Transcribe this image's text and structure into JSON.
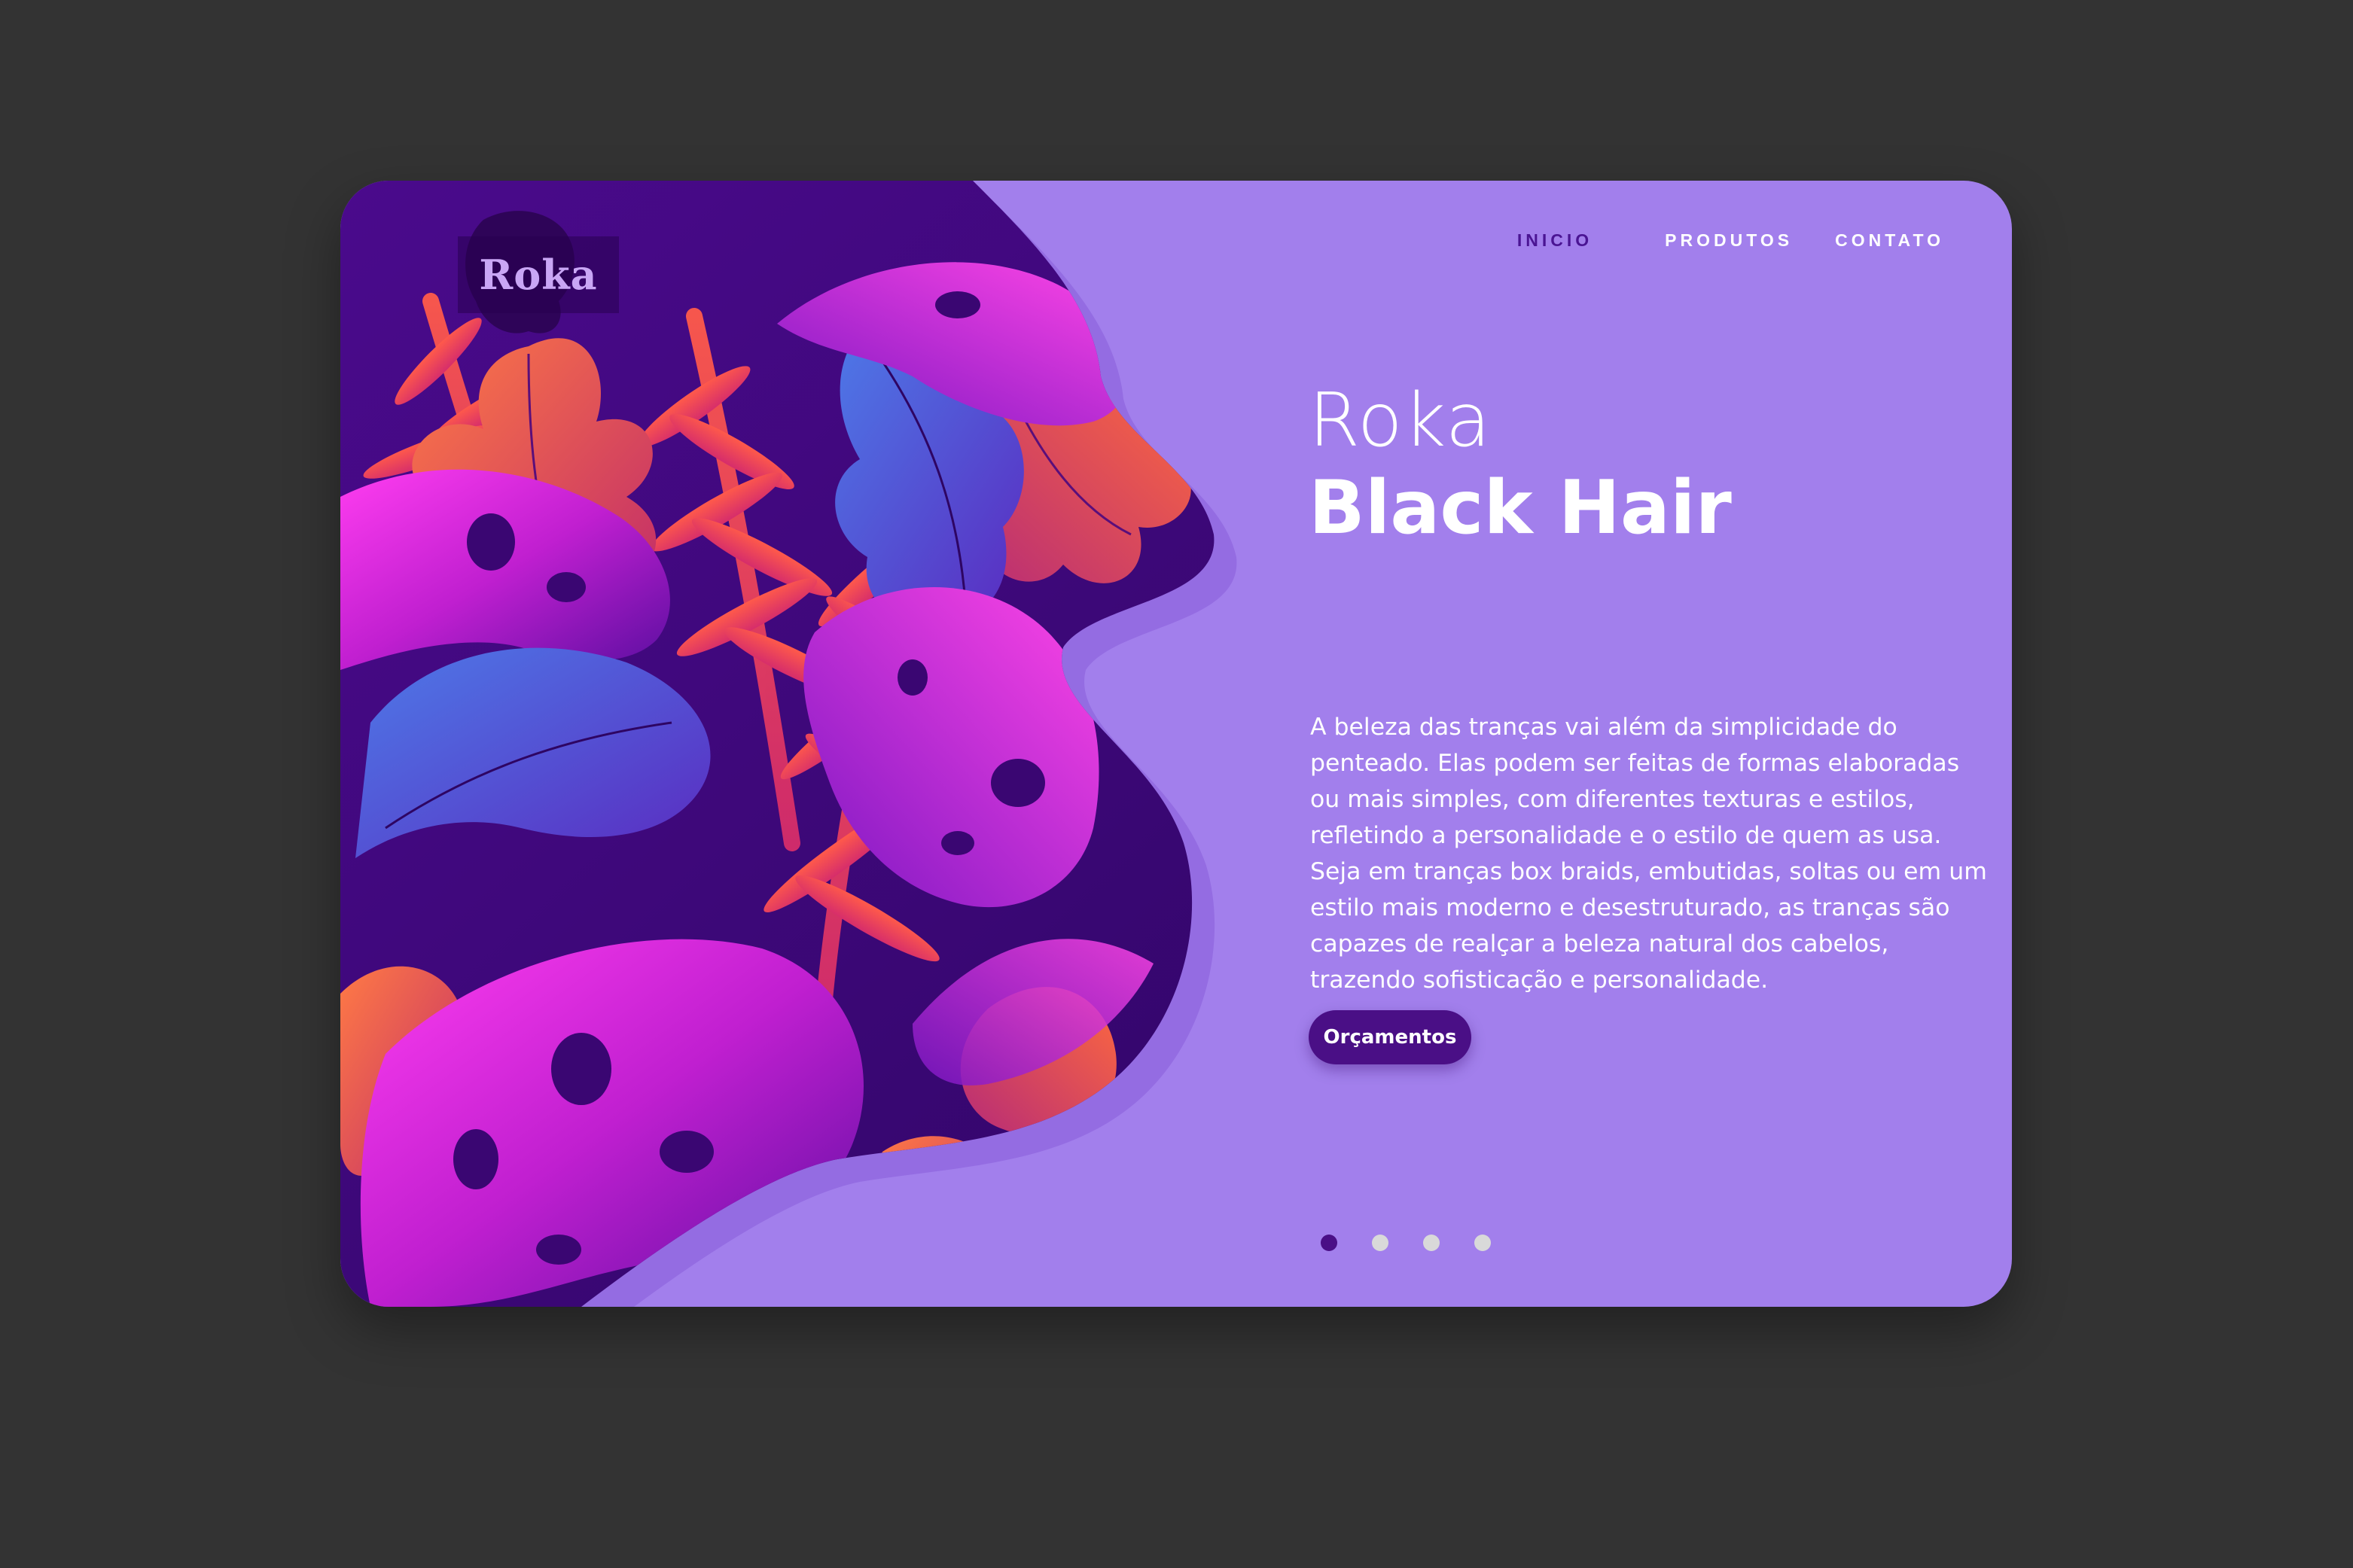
{
  "logo": {
    "text": "Roka"
  },
  "nav": {
    "items": [
      {
        "label": "INICIO",
        "active": true
      },
      {
        "label": "PRODUTOS",
        "active": false
      },
      {
        "label": "CONTATO",
        "active": false
      }
    ]
  },
  "hero": {
    "title_line1": "Roka",
    "title_line2": "Black Hair",
    "description": "A beleza das tranças vai além da simplicidade do penteado. Elas podem ser feitas de formas elaboradas ou mais simples, com diferentes texturas e estilos, refletindo a personalidade e o estilo de quem as usa. Seja em tranças box braids, embutidas, soltas ou em um estilo mais moderno e desestruturado, as tranças são capazes de realçar a beleza natural dos cabelos, trazendo sofisticação e personalidade.",
    "cta_label": "Orçamentos"
  },
  "carousel": {
    "slide_count": 4,
    "active_index": 0
  },
  "colors": {
    "page_background": "#333333",
    "card_background": "#a27fec",
    "accent_dark": "#4a0f86",
    "nav_active": "#4a1493",
    "text": "#ffffff",
    "dot_inactive": "#d9d9d9"
  },
  "icons": {
    "illustration": "tropical-leaves-illustration",
    "logo_silhouette": "woman-silhouette-icon"
  }
}
